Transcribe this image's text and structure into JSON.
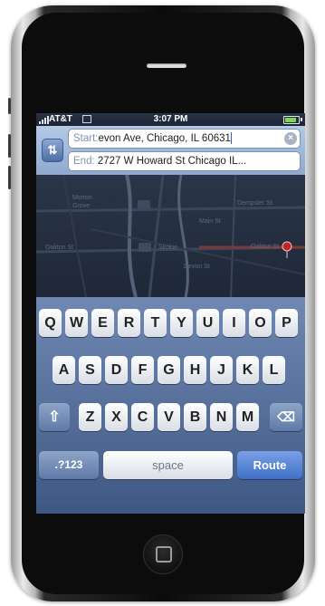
{
  "status_bar": {
    "carrier": "AT&T",
    "time": "3:07 PM"
  },
  "route": {
    "swap_icon": "route-swap-icon",
    "start_label": "Start:",
    "start_value": "evon Ave, Chicago, IL 60631",
    "end_label": "End:",
    "end_value": "2727 W Howard St Chicago IL..."
  },
  "map": {
    "labels": [
      "Morton",
      "Grove",
      "Skokie",
      "Devon St",
      "Dempster St",
      "Oakton St",
      "Oakton St",
      "Main St"
    ]
  },
  "keyboard": {
    "row1": [
      "Q",
      "W",
      "E",
      "R",
      "T",
      "Y",
      "U",
      "I",
      "O",
      "P"
    ],
    "row2": [
      "A",
      "S",
      "D",
      "F",
      "G",
      "H",
      "J",
      "K",
      "L"
    ],
    "row3": [
      "Z",
      "X",
      "C",
      "V",
      "B",
      "N",
      "M"
    ],
    "numbers_label": ".?123",
    "space_label": "space",
    "route_label": "Route"
  },
  "colors": {
    "route_key": "#3e6fc8",
    "keyboard_bg": "#4f6894"
  }
}
